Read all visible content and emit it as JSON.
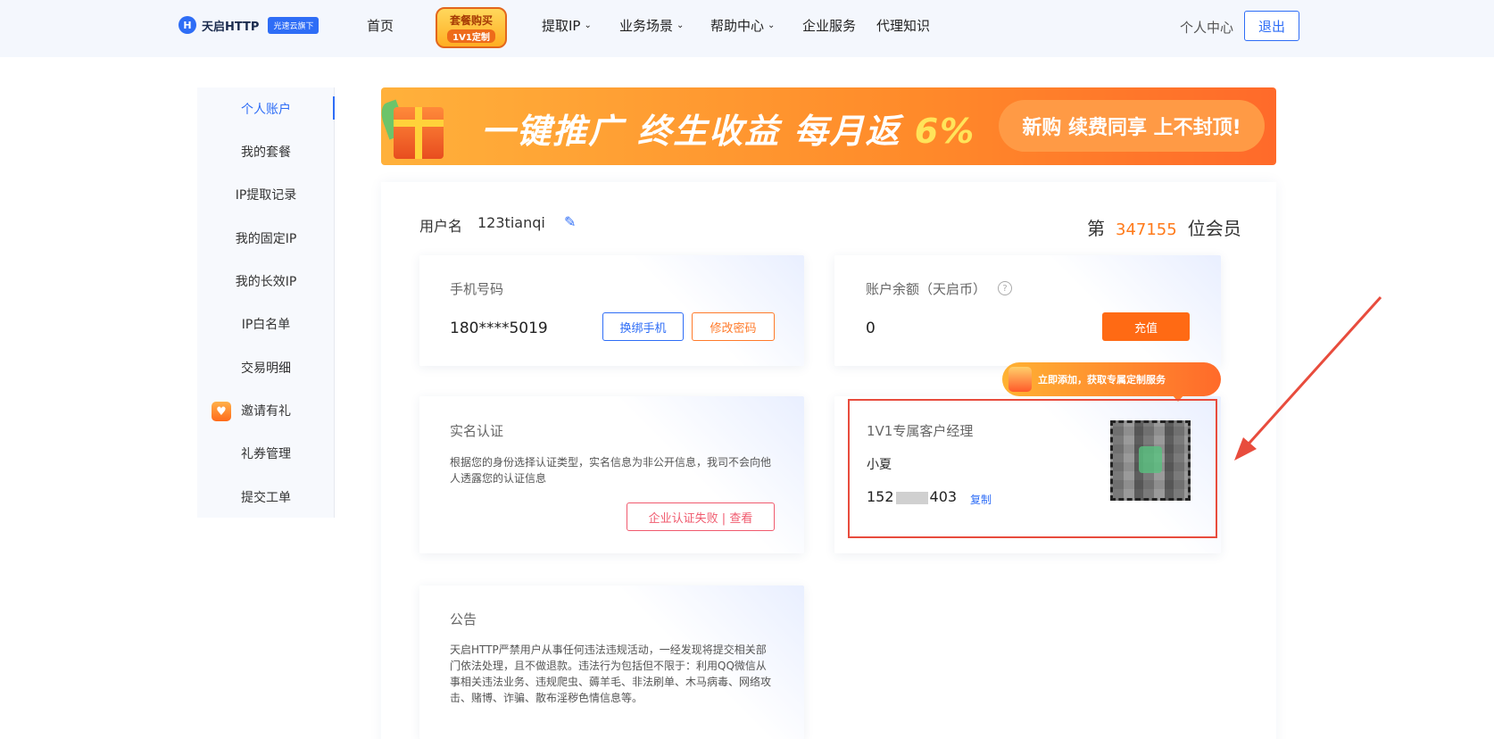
{
  "header": {
    "logo_text": "天启HTTP",
    "logo_badge": "光速云旗下",
    "nav": [
      "首页",
      "提取IP",
      "业务场景",
      "帮助中心",
      "企业服务",
      "代理知识"
    ],
    "promo_line1": "套餐购买",
    "promo_line2": "1V1定制",
    "personal_center": "个人中心",
    "logout": "退出"
  },
  "sidebar": {
    "items": [
      "个人账户",
      "我的套餐",
      "IP提取记录",
      "我的固定IP",
      "我的长效IP",
      "IP白名单",
      "交易明细",
      "邀请有礼",
      "礼券管理",
      "提交工单"
    ],
    "active_index": 0
  },
  "banner": {
    "main_text": "一键推广 终生收益 每月返",
    "percent": "6%",
    "pill_text": "新购 续费同享 上不封顶!"
  },
  "account": {
    "username_label": "用户名",
    "username": "123tianqi",
    "member_prefix": "第",
    "member_number": "347155",
    "member_suffix": "位会员"
  },
  "phone_card": {
    "title": "手机号码",
    "value": "180****5019",
    "rebind_button": "换绑手机",
    "change_password_button": "修改密码"
  },
  "balance_card": {
    "title": "账户余额（天启币）",
    "value": "0",
    "recharge_button": "充值"
  },
  "verify_card": {
    "title": "实名认证",
    "description": "根据您的身份选择认证类型，实名信息为非公开信息，我司不会向他人透露您的认证信息",
    "status_button": "企业认证失败 | 查看"
  },
  "manager_card": {
    "tip": "立即添加，获取专属定制服务",
    "title": "1V1专属客户经理",
    "name": "小夏",
    "phone_prefix": "152",
    "phone_suffix": "403",
    "copy": "复制"
  },
  "notice_card": {
    "title": "公告",
    "text": "天启HTTP严禁用户从事任何违法违规活动，一经发现将提交相关部门依法处理，且不做退款。违法行为包括但不限于：利用QQ微信从事相关违法业务、违规爬虫、薅羊毛、非法刷单、木马病毒、网络攻击、赌博、诈骗、散布淫秽色情信息等。"
  },
  "colors": {
    "brand_blue": "#2e6df6",
    "accent_orange": "#ff6a14",
    "highlight_red": "#e84c3d"
  }
}
